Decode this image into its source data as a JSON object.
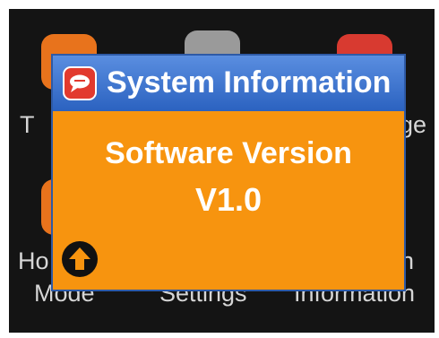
{
  "home_screen": {
    "labels": [
      "T",
      "ge",
      "Ho",
      "n",
      "Mode",
      "Settings",
      "Information"
    ]
  },
  "dialog": {
    "title": "System Information",
    "software_label": "Software Version",
    "version": "V1.0"
  },
  "colors": {
    "dialog_body": "#f7940f",
    "dialog_header": "#3a72cf",
    "screen_background": "#141414",
    "up_button": "#111111"
  },
  "icons": {
    "dialog": "chat-bubble-icon",
    "up_button": "arrow-up-icon"
  }
}
